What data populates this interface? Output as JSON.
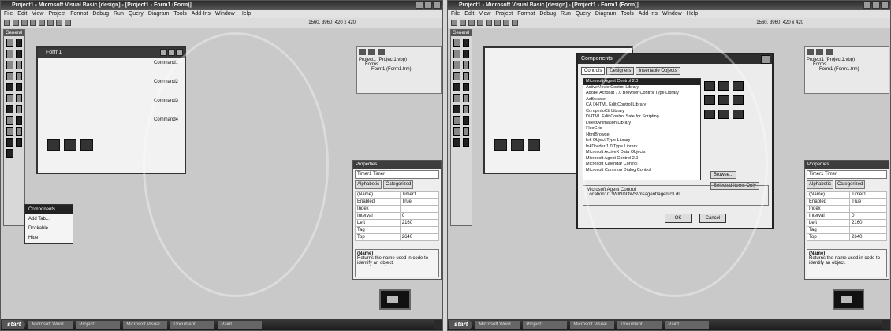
{
  "left": {
    "title": "Project1 - Microsoft Visual Basic [design] - [Project1 - Form1 (Form)]",
    "menu": [
      "File",
      "Edit",
      "View",
      "Project",
      "Format",
      "Debug",
      "Run",
      "Query",
      "Diagram",
      "Tools",
      "Add-Ins",
      "Window",
      "Help"
    ],
    "coords": "1560, 3960",
    "size": "420 x 420",
    "toolbox_title": "General",
    "form_title": "Form1",
    "buttons": [
      "Command1",
      "Command2",
      "Command3",
      "Command4"
    ],
    "project_title": "Project1 (Project1.vbp)",
    "project_forms": "Forms",
    "project_form1": "Form1 (Form1.frm)",
    "props_title": "Timer1 Timer",
    "props_tab_alpha": "Alphabetic",
    "props_tab_cat": "Categorized",
    "props": [
      [
        "(Name)",
        "Timer1"
      ],
      [
        "Enabled",
        "True"
      ],
      [
        "Index",
        ""
      ],
      [
        "Interval",
        "0"
      ],
      [
        "Left",
        "2160"
      ],
      [
        "Tag",
        ""
      ],
      [
        "Top",
        "2640"
      ]
    ],
    "desc_title": "(Name)",
    "desc_text": "Returns the name used in code to identify an object.",
    "menu_title": "Components...",
    "menu_items": [
      "Components...",
      "Add Tab...",
      "Dockable",
      "Hide"
    ]
  },
  "right": {
    "title": "Project1 - Microsoft Visual Basic [design] - [Project1 - Form1 (Form)]",
    "menu": [
      "File",
      "Edit",
      "View",
      "Project",
      "Format",
      "Debug",
      "Run",
      "Query",
      "Diagram",
      "Tools",
      "Add-Ins",
      "Window",
      "Help"
    ],
    "coords": "1560, 3960",
    "size": "420 x 420",
    "toolbox_title": "General",
    "project_title": "Project1 (Project1.vbp)",
    "project_forms": "Forms",
    "project_form1": "Form1 (Form1.frm)",
    "dialog_title": "Components",
    "tabs": [
      "Controls",
      "Designers",
      "Insertable Objects"
    ],
    "components": [
      "Microsoft Agent Control 2.0",
      "ActiveMovie Control Library",
      "Adobe Acrobat 7.0 Browser Control Type Library",
      "AxBrowse",
      "CA DHTML Edit Control Library",
      "CompInfoCtl Library",
      "DHTML Edit Control Safe for Scripting",
      "DirectAnimation Library",
      "FlexGrid",
      "HtmlBrowse",
      "Ink Object Type Library",
      "InkDivider 1.0 Type Library",
      "Microsoft ActiveX Data Objects",
      "Microsoft Agent Control 2.0",
      "Microsoft Calendar Control",
      "Microsoft Common Dialog Control"
    ],
    "browse_label": "Browse...",
    "selected_only": "Selected Items Only",
    "group_title": "Microsoft Agent Control",
    "location_label": "Location:",
    "location": "C:\\WINDOWS\\msagent\\agentctl.dll",
    "ok": "OK",
    "cancel": "Cancel",
    "props_title": "Timer1 Timer",
    "props_tab_alpha": "Alphabetic",
    "props_tab_cat": "Categorized",
    "props": [
      [
        "(Name)",
        "Timer1"
      ],
      [
        "Enabled",
        "True"
      ],
      [
        "Index",
        ""
      ],
      [
        "Interval",
        "0"
      ],
      [
        "Left",
        "2160"
      ],
      [
        "Tag",
        ""
      ],
      [
        "Top",
        "2640"
      ]
    ],
    "desc_title": "(Name)",
    "desc_text": "Returns the name used in code to identify an object."
  },
  "taskbar": {
    "start": "start",
    "tasks_left": [
      "Microsoft Word",
      "Project1",
      "Microsoft Visual",
      "Document",
      "Paint"
    ],
    "tasks_right": [
      "Microsoft Word",
      "Project1",
      "Microsoft Visual",
      "Document",
      "Paint"
    ]
  }
}
